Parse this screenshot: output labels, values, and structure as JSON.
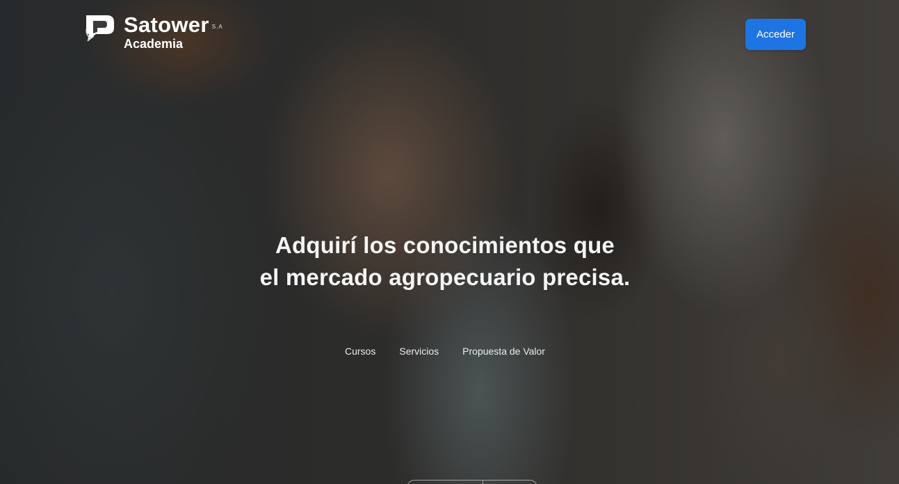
{
  "brand": {
    "name": "Satower",
    "suffix": "S.A",
    "subtitle": "Academia",
    "logo_icon": "speech-bubble-p-logo"
  },
  "header": {
    "access_button": "Acceder",
    "accent_color": "#1f74e3"
  },
  "hero": {
    "headline_line1": "Adquirí los conocimientos que",
    "headline_line2": "el mercado agropecuario precisa."
  },
  "nav": {
    "items": [
      {
        "label": "Cursos"
      },
      {
        "label": "Servicios"
      },
      {
        "label": "Propuesta de Valor"
      }
    ]
  }
}
